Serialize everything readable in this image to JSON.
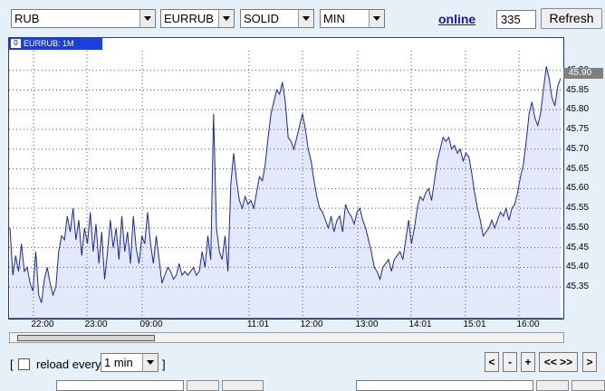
{
  "toolbar": {
    "currency": "RUB",
    "symbol": "EURRUB",
    "style": "SOLID",
    "interval": "MIN",
    "online_label": "online",
    "count_value": "335",
    "refresh_label": "Refresh"
  },
  "chart_panel": {
    "series_tab_index": "0",
    "series_tab_label": "EURRUB: 1M",
    "last_value_label": "45.90"
  },
  "footer": {
    "reload_bracket_open": "[",
    "reload_label": "reload every",
    "reload_interval": "1 min",
    "reload_bracket_close": "]",
    "nav_first": "<",
    "nav_minus": "-",
    "nav_plus": "+",
    "nav_all": "<< >>",
    "nav_last": ">"
  },
  "chart_data": {
    "type": "area",
    "ylim": [
      45.27,
      45.95
    ],
    "y_ticks": [
      "45.35",
      "45.40",
      "45.45",
      "45.50",
      "45.55",
      "45.60",
      "45.65",
      "45.70",
      "45.75",
      "45.80",
      "45.85",
      "45.90"
    ],
    "x_ticks": [
      "22:00",
      "23:00",
      "09:00",
      "11:01",
      "12:00",
      "13:00",
      "14:01",
      "15:01",
      "16:00"
    ],
    "grid": true,
    "colors": {
      "line": "#1a2a9c",
      "fill": "#e3e8fa",
      "grid": "#555555",
      "tab": "#1a40d8"
    },
    "series": [
      {
        "values": [
          45.5,
          45.38,
          45.43,
          45.39,
          45.46,
          45.39,
          45.4,
          45.36,
          45.34,
          45.44,
          45.33,
          45.31,
          45.37,
          45.4,
          45.36,
          45.33,
          45.35,
          45.44,
          45.48,
          45.47,
          45.53,
          45.49,
          45.55,
          45.47,
          45.52,
          45.43,
          45.5,
          45.46,
          45.54,
          45.44,
          45.51,
          45.41,
          45.49,
          45.37,
          45.44,
          45.52,
          45.45,
          45.5,
          45.42,
          45.53,
          45.44,
          45.49,
          45.41,
          45.53,
          45.45,
          45.41,
          45.48,
          45.46,
          45.54,
          45.46,
          45.41,
          45.48,
          45.42,
          45.36,
          45.38,
          45.4,
          45.39,
          45.37,
          45.38,
          45.41,
          45.38,
          45.39,
          45.38,
          45.39,
          45.4,
          45.38,
          45.39,
          45.44,
          45.4,
          45.48,
          45.42,
          45.79,
          45.5,
          45.44,
          45.42,
          45.48,
          45.39,
          45.61,
          45.69,
          45.62,
          45.57,
          45.55,
          45.58,
          45.56,
          45.57,
          45.55,
          45.59,
          45.63,
          45.62,
          45.66,
          45.73,
          45.79,
          45.82,
          45.85,
          45.84,
          45.87,
          45.82,
          45.73,
          45.72,
          45.7,
          45.73,
          45.76,
          45.79,
          45.75,
          45.7,
          45.67,
          45.62,
          45.58,
          45.55,
          45.54,
          45.52,
          45.5,
          45.53,
          45.49,
          45.52,
          45.53,
          45.49,
          45.56,
          45.54,
          45.53,
          45.51,
          45.54,
          45.55,
          45.52,
          45.5,
          45.47,
          45.44,
          45.4,
          45.39,
          45.37,
          45.4,
          45.41,
          45.42,
          45.39,
          45.42,
          45.43,
          45.44,
          45.42,
          45.47,
          45.52,
          45.46,
          45.5,
          45.55,
          45.58,
          45.57,
          45.59,
          45.6,
          45.57,
          45.62,
          45.67,
          45.7,
          45.73,
          45.72,
          45.73,
          45.7,
          45.71,
          45.69,
          45.7,
          45.67,
          45.69,
          45.68,
          45.64,
          45.59,
          45.55,
          45.52,
          45.48,
          45.49,
          45.5,
          45.52,
          45.5,
          45.52,
          45.54,
          45.53,
          45.55,
          45.52,
          45.55,
          45.56,
          45.59,
          45.63,
          45.66,
          45.72,
          45.79,
          45.82,
          45.78,
          45.76,
          45.79,
          45.85,
          45.91,
          45.88,
          45.83,
          45.81,
          45.86,
          45.88
        ]
      }
    ]
  }
}
